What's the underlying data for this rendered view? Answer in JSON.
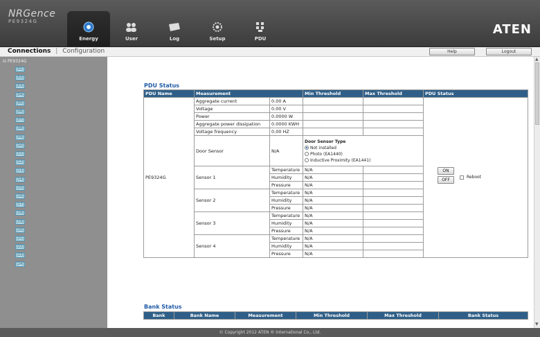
{
  "header": {
    "logo_line1": "NRGence",
    "logo_line2": "PE9324G",
    "brand": "ATEN",
    "tabs": [
      {
        "label": "Energy",
        "icon": "energy-icon",
        "active": true
      },
      {
        "label": "User",
        "icon": "user-icon",
        "active": false
      },
      {
        "label": "Log",
        "icon": "log-icon",
        "active": false
      },
      {
        "label": "Setup",
        "icon": "setup-icon",
        "active": false
      },
      {
        "label": "PDU",
        "icon": "pdu-icon",
        "active": false
      }
    ]
  },
  "subnav": {
    "connections": "Connections",
    "separator": "|",
    "configuration": "Configuration",
    "help": "Help",
    "logout": "Logout"
  },
  "sidebar": {
    "root": "PE9324G",
    "items": [
      "[01]",
      "[02]",
      "[03]",
      "[04]",
      "[05]",
      "[06]",
      "[07]",
      "[08]",
      "[09]",
      "[10]",
      "[11]",
      "[12]",
      "[13]",
      "[14]",
      "[15]",
      "[16]",
      "[17]",
      "[18]",
      "[19]",
      "[20]",
      "[21]",
      "[22]",
      "[23]",
      "[24]"
    ]
  },
  "pdu_status": {
    "title": "PDU Status",
    "headers": [
      "PDU Name",
      "Measurement",
      "",
      "Min Threshold",
      "Max Threshold",
      "PDU Status"
    ],
    "pdu_name": "PE9324G",
    "measurements": [
      {
        "label": "Aggregate current",
        "value": "0.00 A"
      },
      {
        "label": "Voltage",
        "value": "0.00 V"
      },
      {
        "label": "Power",
        "value": "0.0000 W"
      },
      {
        "label": "Aggregate power dissipation",
        "value": "0.0000 KWH"
      },
      {
        "label": "Voltage frequency",
        "value": "0.00 HZ"
      }
    ],
    "door_sensor": {
      "label": "Door Sensor",
      "value": "N/A",
      "type_title": "Door Sensor Type",
      "options": [
        "Not installed",
        "Photo (EA1440)",
        "Inductive Proximity (EA1441)"
      ],
      "selected": "Not installed"
    },
    "sensors": [
      {
        "name": "Sensor 1",
        "rows": [
          {
            "label": "Temperature",
            "value": "N/A"
          },
          {
            "label": "Humidity",
            "value": "N/A"
          },
          {
            "label": "Pressure",
            "value": "N/A"
          }
        ]
      },
      {
        "name": "Sensor 2",
        "rows": [
          {
            "label": "Temperature",
            "value": "N/A"
          },
          {
            "label": "Humidity",
            "value": "N/A"
          },
          {
            "label": "Pressure",
            "value": "N/A"
          }
        ]
      },
      {
        "name": "Sensor 3",
        "rows": [
          {
            "label": "Temperature",
            "value": "N/A"
          },
          {
            "label": "Humidity",
            "value": "N/A"
          },
          {
            "label": "Pressure",
            "value": "N/A"
          }
        ]
      },
      {
        "name": "Sensor 4",
        "rows": [
          {
            "label": "Temperature",
            "value": "N/A"
          },
          {
            "label": "Humidity",
            "value": "N/A"
          },
          {
            "label": "Pressure",
            "value": "N/A"
          }
        ]
      }
    ],
    "controls": {
      "on": "ON",
      "off": "OFF",
      "reboot": "Reboot"
    }
  },
  "bank_status": {
    "title": "Bank Status",
    "headers": [
      "Bank",
      "Bank Name",
      "Measurement",
      "Min Threshold",
      "Max Threshold",
      "Bank Status"
    ]
  },
  "footer": {
    "text": "© Copyright 2012 ATEN ® International Co., Ltd."
  }
}
